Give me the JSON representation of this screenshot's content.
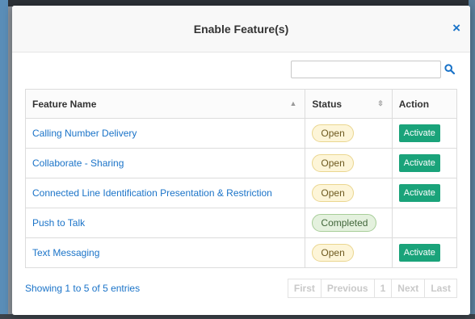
{
  "modal": {
    "title": "Enable Feature(s)",
    "close_symbol": "×"
  },
  "search": {
    "value": "",
    "placeholder": ""
  },
  "table": {
    "headers": {
      "feature": "Feature Name",
      "status": "Status",
      "action": "Action"
    },
    "rows": [
      {
        "feature": "Calling Number Delivery",
        "status": "Open",
        "action": "Activate"
      },
      {
        "feature": "Collaborate - Sharing",
        "status": "Open",
        "action": "Activate"
      },
      {
        "feature": "Connected Line Identification Presentation & Restriction",
        "status": "Open",
        "action": "Activate"
      },
      {
        "feature": "Push to Talk",
        "status": "Completed",
        "action": ""
      },
      {
        "feature": "Text Messaging",
        "status": "Open",
        "action": "Activate"
      }
    ]
  },
  "footer": {
    "info": "Showing 1 to 5 of 5 entries",
    "pager": {
      "first": "First",
      "previous": "Previous",
      "page": "1",
      "next": "Next",
      "last": "Last"
    }
  },
  "colors": {
    "link": "#1a73c8",
    "activate": "#1aa37a",
    "open_badge": "#fdf5d8",
    "completed_badge": "#e4f1de"
  }
}
